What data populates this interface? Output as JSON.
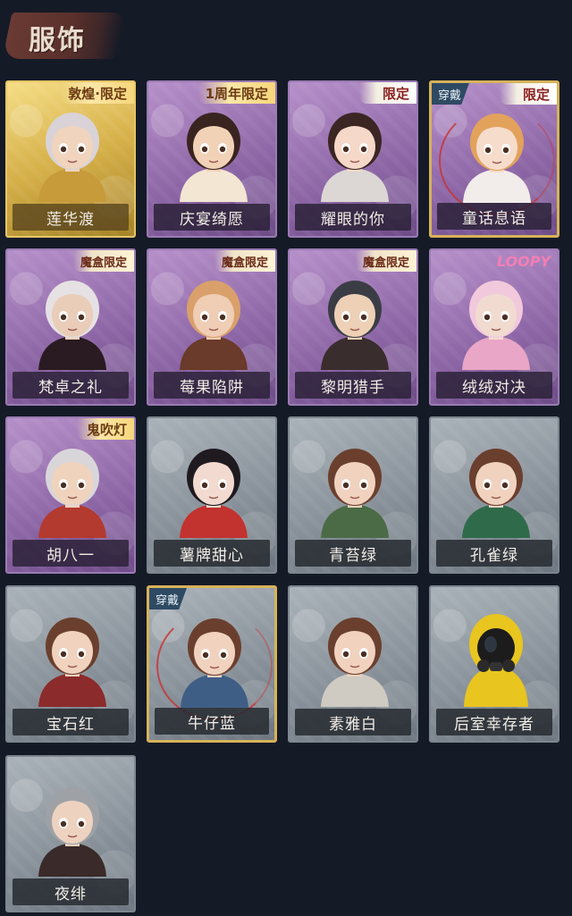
{
  "header": {
    "title": "服饰"
  },
  "costumes": [
    {
      "name": "莲华渡",
      "badge": "敦煌·限定",
      "badge_style": "gold",
      "style": "gold",
      "equipped": false,
      "hair": "#d9d3d8",
      "skin": "#f0d4bd",
      "outfit": "#c79a3a",
      "icon": "character-portrait-icon"
    },
    {
      "name": "庆宴绮愿",
      "badge": "1周年限定",
      "badge_style": "gold",
      "style": "purple",
      "equipped": false,
      "hair": "#3a2420",
      "skin": "#f2d2b6",
      "outfit": "#f3e6d2",
      "icon": "character-portrait-icon"
    },
    {
      "name": "耀眼的你",
      "badge": "限定",
      "badge_style": "limited",
      "style": "purple",
      "equipped": false,
      "hair": "#3b2624",
      "skin": "#f5d8c8",
      "outfit": "#dcd7d4",
      "icon": "character-portrait-icon"
    },
    {
      "name": "童话息语",
      "badge": "限定",
      "badge_style": "limited",
      "style": "purple",
      "equipped": true,
      "worn_label": "穿戴",
      "hair": "#e3a25c",
      "skin": "#f6dccb",
      "outfit": "#f2ecea",
      "icon": "character-portrait-icon"
    },
    {
      "name": "梵卓之礼",
      "badge": "魔盒限定",
      "badge_style": "box",
      "style": "purple",
      "equipped": false,
      "hair": "#e6e1e3",
      "skin": "#e9cdb9",
      "outfit": "#2a1b22",
      "icon": "character-portrait-icon"
    },
    {
      "name": "莓果陷阱",
      "badge": "魔盒限定",
      "badge_style": "box",
      "style": "purple",
      "equipped": false,
      "hair": "#d9a06b",
      "skin": "#f0cdb5",
      "outfit": "#6a3a2a",
      "icon": "character-portrait-icon"
    },
    {
      "name": "黎明猎手",
      "badge": "魔盒限定",
      "badge_style": "box",
      "style": "purple",
      "equipped": false,
      "hair": "#3b3d45",
      "skin": "#edd0b6",
      "outfit": "#3a2d2d",
      "icon": "character-portrait-icon"
    },
    {
      "name": "绒绒对决",
      "badge": "LOOPY",
      "badge_style": "collab",
      "style": "purple",
      "equipped": false,
      "hair": "#f2c9dc",
      "skin": "#f1dbd0",
      "outfit": "#e9a6c6",
      "icon": "character-portrait-icon"
    },
    {
      "name": "胡八一",
      "badge": "鬼吹灯",
      "badge_style": "gold",
      "style": "purple",
      "equipped": false,
      "hair": "#d9d6da",
      "skin": "#efd3bc",
      "outfit": "#b33a2e",
      "icon": "character-portrait-icon"
    },
    {
      "name": "薯牌甜心",
      "badge": "",
      "badge_style": "none",
      "style": "gray",
      "equipped": false,
      "hair": "#1f1a1f",
      "skin": "#f2dad0",
      "outfit": "#c2322f",
      "icon": "character-portrait-icon"
    },
    {
      "name": "青苔绿",
      "badge": "",
      "badge_style": "none",
      "style": "gray",
      "equipped": false,
      "hair": "#6b3f2e",
      "skin": "#f0d2bf",
      "outfit": "#4b6b47",
      "icon": "character-portrait-icon"
    },
    {
      "name": "孔雀绿",
      "badge": "",
      "badge_style": "none",
      "style": "gray",
      "equipped": false,
      "hair": "#6b3f2e",
      "skin": "#f0d2bf",
      "outfit": "#2f6b4a",
      "icon": "character-portrait-icon"
    },
    {
      "name": "宝石红",
      "badge": "",
      "badge_style": "none",
      "style": "gray",
      "equipped": false,
      "hair": "#6b3f2e",
      "skin": "#f0d2bf",
      "outfit": "#8c2b2b",
      "icon": "character-portrait-icon"
    },
    {
      "name": "牛仔蓝",
      "badge": "",
      "badge_style": "none",
      "style": "gray",
      "equipped": true,
      "worn_label": "穿戴",
      "hair": "#6b3f2e",
      "skin": "#f0d2bf",
      "outfit": "#3f5e86",
      "icon": "character-portrait-icon"
    },
    {
      "name": "素雅白",
      "badge": "",
      "badge_style": "none",
      "style": "gray",
      "equipped": false,
      "hair": "#6b3f2e",
      "skin": "#f0d2bf",
      "outfit": "#cfcac2",
      "icon": "character-portrait-icon"
    },
    {
      "name": "后室幸存者",
      "badge": "",
      "badge_style": "none",
      "style": "gray",
      "equipped": false,
      "hair": "#e8c51f",
      "skin": "#1c1c1c",
      "outfit": "#e8c51f",
      "icon": "hazmat-suit-icon"
    },
    {
      "name": "夜绯",
      "badge": "",
      "badge_style": "none",
      "style": "gray",
      "equipped": false,
      "hair": "#9ea2a6",
      "skin": "#edd3bf",
      "outfit": "#3a2a2a",
      "icon": "character-portrait-icon"
    }
  ]
}
